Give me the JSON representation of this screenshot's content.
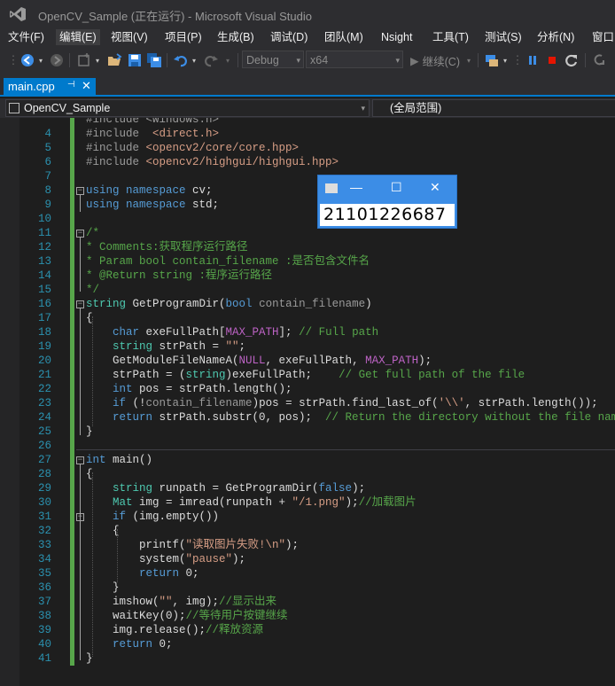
{
  "window": {
    "title": "OpenCV_Sample (正在运行) - Microsoft Visual Studio"
  },
  "menu": [
    "文件(F)",
    "编辑(E)",
    "视图(V)",
    "项目(P)",
    "生成(B)",
    "调试(D)",
    "团队(M)",
    "Nsight",
    "工具(T)",
    "测试(S)",
    "分析(N)",
    "窗口"
  ],
  "toolbar": {
    "config": "Debug",
    "platform": "x64",
    "continue_label": "继续(C)"
  },
  "tab": {
    "label": "main.cpp"
  },
  "nav": {
    "scope": "OpenCV_Sample",
    "member": "(全局范围)"
  },
  "popup": {
    "image_text": "21101226687"
  },
  "code": [
    {
      "n": "",
      "segs": [
        [
          "#include <windows.h>",
          "#9b9b9b"
        ]
      ]
    },
    {
      "n": "4",
      "segs": [
        [
          "#include  ",
          "#9b9b9b"
        ],
        [
          "<direct.h>",
          "#d69d85"
        ]
      ]
    },
    {
      "n": "5",
      "segs": [
        [
          "#include ",
          "#9b9b9b"
        ],
        [
          "<opencv2/core/core.hpp>",
          "#d69d85"
        ]
      ]
    },
    {
      "n": "6",
      "segs": [
        [
          "#include ",
          "#9b9b9b"
        ],
        [
          "<opencv2/highgui/highgui.hpp>",
          "#d69d85"
        ]
      ]
    },
    {
      "n": "7",
      "segs": []
    },
    {
      "n": "8",
      "segs": [
        [
          "using namespace ",
          "#569cd6"
        ],
        [
          "cv;",
          "#dcdcdc"
        ]
      ]
    },
    {
      "n": "9",
      "segs": [
        [
          "using namespace ",
          "#569cd6"
        ],
        [
          "std;",
          "#dcdcdc"
        ]
      ]
    },
    {
      "n": "10",
      "segs": []
    },
    {
      "n": "11",
      "segs": [
        [
          "/*",
          "#57a64a"
        ]
      ]
    },
    {
      "n": "12",
      "segs": [
        [
          "* Comments:获取程序运行路径",
          "#57a64a"
        ]
      ]
    },
    {
      "n": "13",
      "segs": [
        [
          "* Param bool contain_filename :是否包含文件名",
          "#57a64a"
        ]
      ]
    },
    {
      "n": "14",
      "segs": [
        [
          "* @Return string :程序运行路径",
          "#57a64a"
        ]
      ]
    },
    {
      "n": "15",
      "segs": [
        [
          "*/",
          "#57a64a"
        ]
      ]
    },
    {
      "n": "16",
      "segs": [
        [
          "string ",
          "#4ec9b0"
        ],
        [
          "GetProgramDir(",
          "#dcdcdc"
        ],
        [
          "bool ",
          "#569cd6"
        ],
        [
          "contain_filename",
          "#9a9a9a"
        ],
        [
          ")",
          "#dcdcdc"
        ]
      ]
    },
    {
      "n": "17",
      "segs": [
        [
          "{",
          "#dcdcdc"
        ]
      ]
    },
    {
      "n": "18",
      "segs": [
        [
          "    char ",
          "#569cd6"
        ],
        [
          "exeFullPath[",
          "#dcdcdc"
        ],
        [
          "MAX_PATH",
          "#bd63c5"
        ],
        [
          "]; ",
          "#dcdcdc"
        ],
        [
          "// Full path",
          "#57a64a"
        ]
      ]
    },
    {
      "n": "19",
      "segs": [
        [
          "    string ",
          "#4ec9b0"
        ],
        [
          "strPath = ",
          "#dcdcdc"
        ],
        [
          "\"\"",
          "#d69d85"
        ],
        [
          ";",
          "#dcdcdc"
        ]
      ]
    },
    {
      "n": "20",
      "segs": [
        [
          "    GetModuleFileNameA(",
          "#dcdcdc"
        ],
        [
          "NULL",
          "#bd63c5"
        ],
        [
          ", exeFullPath, ",
          "#dcdcdc"
        ],
        [
          "MAX_PATH",
          "#bd63c5"
        ],
        [
          ");",
          "#dcdcdc"
        ]
      ]
    },
    {
      "n": "21",
      "segs": [
        [
          "    strPath = (",
          "#dcdcdc"
        ],
        [
          "string",
          "#4ec9b0"
        ],
        [
          ")exeFullPath;    ",
          "#dcdcdc"
        ],
        [
          "// Get full path of the file",
          "#57a64a"
        ]
      ]
    },
    {
      "n": "22",
      "segs": [
        [
          "    int ",
          "#569cd6"
        ],
        [
          "pos = strPath.length();",
          "#dcdcdc"
        ]
      ]
    },
    {
      "n": "23",
      "segs": [
        [
          "    if ",
          "#569cd6"
        ],
        [
          "(!",
          "#dcdcdc"
        ],
        [
          "contain_filename",
          "#9a9a9a"
        ],
        [
          ")pos = strPath.find_last_of(",
          "#dcdcdc"
        ],
        [
          "'\\\\'",
          "#d69d85"
        ],
        [
          ", strPath.length());",
          "#dcdcdc"
        ]
      ]
    },
    {
      "n": "24",
      "segs": [
        [
          "    return ",
          "#569cd6"
        ],
        [
          "strPath.substr(0, pos);  ",
          "#dcdcdc"
        ],
        [
          "// Return the directory without the file name",
          "#57a64a"
        ]
      ]
    },
    {
      "n": "25",
      "segs": [
        [
          "}",
          "#dcdcdc"
        ]
      ]
    },
    {
      "n": "26",
      "segs": []
    },
    {
      "n": "27",
      "segs": [
        [
          "int ",
          "#569cd6"
        ],
        [
          "main()",
          "#dcdcdc"
        ]
      ]
    },
    {
      "n": "28",
      "segs": [
        [
          "{",
          "#dcdcdc"
        ]
      ]
    },
    {
      "n": "29",
      "segs": [
        [
          "    string ",
          "#4ec9b0"
        ],
        [
          "runpath = GetProgramDir(",
          "#dcdcdc"
        ],
        [
          "false",
          "#569cd6"
        ],
        [
          ");",
          "#dcdcdc"
        ]
      ]
    },
    {
      "n": "30",
      "segs": [
        [
          "    Mat ",
          "#4ec9b0"
        ],
        [
          "img = imread(runpath + ",
          "#dcdcdc"
        ],
        [
          "\"/1.png\"",
          "#d69d85"
        ],
        [
          ");",
          "#dcdcdc"
        ],
        [
          "//加载图片",
          "#57a64a"
        ]
      ]
    },
    {
      "n": "31",
      "segs": [
        [
          "    if ",
          "#569cd6"
        ],
        [
          "(img.empty())",
          "#dcdcdc"
        ]
      ]
    },
    {
      "n": "32",
      "segs": [
        [
          "    {",
          "#dcdcdc"
        ]
      ]
    },
    {
      "n": "33",
      "segs": [
        [
          "        printf(",
          "#dcdcdc"
        ],
        [
          "\"读取图片失败!\\n\"",
          "#d69d85"
        ],
        [
          ");",
          "#dcdcdc"
        ]
      ]
    },
    {
      "n": "34",
      "segs": [
        [
          "        system(",
          "#dcdcdc"
        ],
        [
          "\"pause\"",
          "#d69d85"
        ],
        [
          ");",
          "#dcdcdc"
        ]
      ]
    },
    {
      "n": "35",
      "segs": [
        [
          "        return ",
          "#569cd6"
        ],
        [
          "0;",
          "#dcdcdc"
        ]
      ]
    },
    {
      "n": "36",
      "segs": [
        [
          "    }",
          "#dcdcdc"
        ]
      ]
    },
    {
      "n": "37",
      "segs": [
        [
          "    imshow(",
          "#dcdcdc"
        ],
        [
          "\"\"",
          "#d69d85"
        ],
        [
          ", img);",
          "#dcdcdc"
        ],
        [
          "//显示出来",
          "#57a64a"
        ]
      ]
    },
    {
      "n": "38",
      "segs": [
        [
          "    waitKey(0);",
          "#dcdcdc"
        ],
        [
          "//等待用户按键继续",
          "#57a64a"
        ]
      ]
    },
    {
      "n": "39",
      "segs": [
        [
          "    img.release();",
          "#dcdcdc"
        ],
        [
          "//释放资源",
          "#57a64a"
        ]
      ]
    },
    {
      "n": "40",
      "segs": [
        [
          "    return ",
          "#569cd6"
        ],
        [
          "0;",
          "#dcdcdc"
        ]
      ]
    },
    {
      "n": "41",
      "segs": [
        [
          "}",
          "#dcdcdc"
        ]
      ]
    }
  ]
}
